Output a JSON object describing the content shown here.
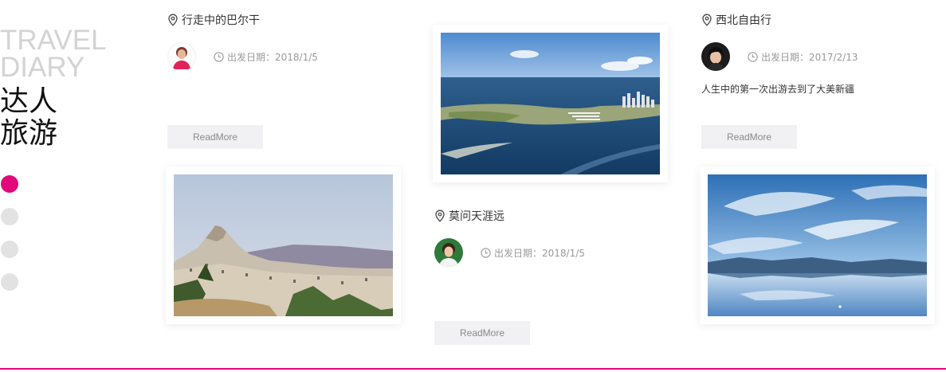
{
  "brand": {
    "en_line1": "TRAVEL",
    "en_line2": "DIARY",
    "cn_line1": "达人",
    "cn_line2": "旅游"
  },
  "pager": {
    "count": 4,
    "active_index": 0,
    "active_color": "#e0087a",
    "inactive_color": "#e2e2e2"
  },
  "cards": [
    {
      "location": "行走中的巴尔干",
      "date_label": "出发日期：2018/1/5",
      "description": "",
      "read_more": "ReadMore"
    },
    {
      "location": "莫问天涯远",
      "date_label": "出发日期：2018/1/5",
      "description": "",
      "read_more": "ReadMore"
    },
    {
      "location": "西北自由行",
      "date_label": "出发日期：2017/2/13",
      "description": "人生中的第一次出游去到了大美新疆",
      "read_more": "ReadMore"
    }
  ],
  "icons": {
    "location": "location-pin-icon",
    "date": "clock-icon"
  },
  "accent_color": "#e0087a"
}
